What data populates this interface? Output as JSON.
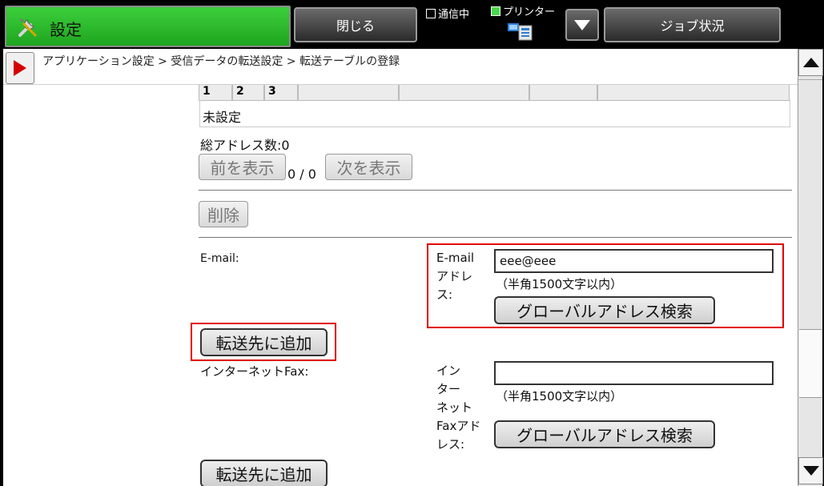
{
  "topbar": {
    "mode_title": "設定",
    "close_label": "閉じる",
    "job_label": "ジョブ状況",
    "status_comm": "通信中",
    "status_printer": "プリンター"
  },
  "breadcrumb": "アプリケーション設定 > 受信データの転送設定 > 転送テーブルの登録",
  "tabs": [
    "1",
    "2",
    "3",
    "",
    "",
    "",
    "",
    ""
  ],
  "unset_label": "未設定",
  "total_address_label": "総アドレス数:0",
  "pager": {
    "prev_label": "前を表示",
    "count": "0 / 0",
    "next_label": "次を表示"
  },
  "delete_label": "削除",
  "email": {
    "section_label": "E-mail:",
    "field_label_lines": [
      "E-mail",
      "アドレ",
      "ス:"
    ],
    "value": "eee@eee",
    "hint": "（半角1500文字以内）",
    "search_label": "グローバルアドレス検索",
    "add_label": "転送先に追加"
  },
  "ifax": {
    "section_label": "インターネットFax:",
    "field_label_lines": [
      "イン",
      "ター",
      "ネット",
      "Faxアド",
      "レス:"
    ],
    "value": "",
    "hint": "（半角1500文字以内）",
    "search_label": "グローバルアドレス検索",
    "add_label": "転送先に追加"
  },
  "colors": {
    "mode_green": "#22b822",
    "highlight_red": "#e00000",
    "crumb_arrow": "#d40000"
  }
}
